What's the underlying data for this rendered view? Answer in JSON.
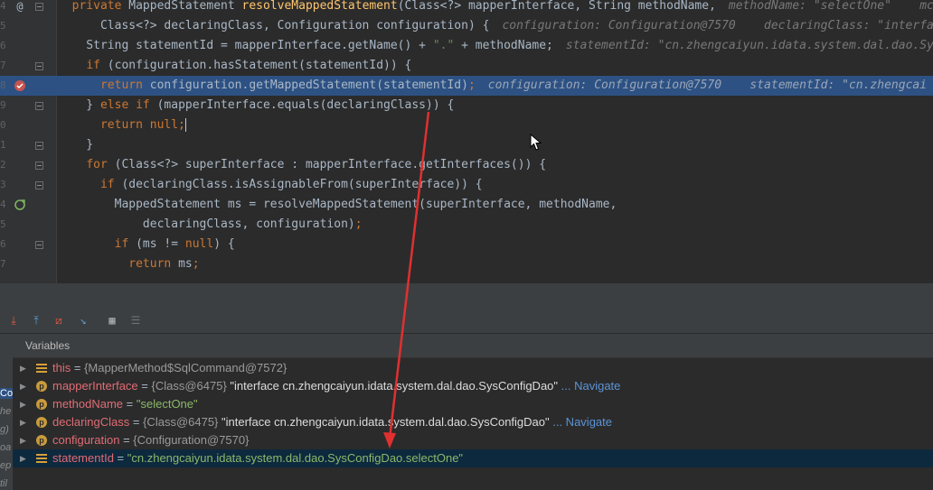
{
  "editor": {
    "lines": [
      {
        "num": "4",
        "html": "  <span class=\"kw\">private</span> MappedStatement <span class=\"fn\">resolveMappedStatement</span>(Class&lt;?&gt; mapperInterface, String methodName,<span class=\"hint\">methodName: \"selectOne\"    mc</span>",
        "gutter_icon": "@",
        "fold": true
      },
      {
        "num": "5",
        "html": "      Class&lt;?&gt; declaringClass, Configuration configuration) {<span class=\"hint\">configuration: Configuration@7570    declaringClass: \"interfa</span>",
        "fold": false
      },
      {
        "num": "6",
        "html": "    String statementId = mapperInterface.getName() + <span class=\"str\">\".\"</span> + methodName;<span class=\"hint\">statementId: \"cn.zhengcaiyun.idata.system.dal.dao.Sy</span>",
        "fold": false
      },
      {
        "num": "7",
        "html": "    <span class=\"kw\">if</span> (configuration.hasStatement(statementId)) {",
        "fold": true
      },
      {
        "num": "8",
        "html": "      <span class=\"kw\">return</span> configuration.getMappedStatement(statementId)<span class=\"kw\">;</span><span class=\"hint\">configuration: Configuration@7570    statementId: \"cn.zhengcai</span>",
        "gutter_icon": "breakpoint",
        "highlight": true,
        "fold": false
      },
      {
        "num": "9",
        "html": "    } <span class=\"kw\">else if</span> (mapperInterface.equals(declaringClass)) {",
        "fold": true
      },
      {
        "num": "0",
        "html": "      <span class=\"kw\">return null;</span><span class=\"caret\"></span>",
        "fold": false
      },
      {
        "num": "1",
        "html": "    }",
        "fold": true
      },
      {
        "num": "2",
        "html": "    <span class=\"kw\">for</span> (Class&lt;?&gt; superInterface : mapperInterface.getInterfaces()) {",
        "fold": true
      },
      {
        "num": "3",
        "html": "      <span class=\"kw\">if</span> (declaringClass.isAssignableFrom(superInterface)) {",
        "fold": true
      },
      {
        "num": "4",
        "html": "        MappedStatement ms = resolveMappedStatement(superInterface, methodName,",
        "gutter_icon": "recursion",
        "fold": false
      },
      {
        "num": "5",
        "html": "            declaringClass, configuration)<span class=\"kw\">;</span>",
        "fold": false
      },
      {
        "num": "6",
        "html": "        <span class=\"kw\">if</span> (ms != <span class=\"kw\">null</span>) {",
        "fold": true
      },
      {
        "num": "7",
        "html": "          <span class=\"kw\">return</span> ms<span class=\"kw\">;</span>",
        "fold": false
      }
    ]
  },
  "toolbar": {
    "buttons": [
      "step-into-icon",
      "step-out-icon",
      "drop-frame-icon",
      "run-to-cursor-icon",
      "evaluate-icon",
      "trace-icon"
    ]
  },
  "variables": {
    "title": "Variables",
    "rows": [
      {
        "icon": "lines",
        "name": "this",
        "eq": " = ",
        "value_obj": "{MapperMethod$SqlCommand@7572}",
        "value_str": "",
        "nav": ""
      },
      {
        "icon": "p",
        "name": "mapperInterface",
        "eq": " = ",
        "value_obj": "{Class@6475}",
        "value_str": " \"interface cn.zhengcaiyun.idata.system.dal.dao.SysConfigDao\"",
        "nav": " ... Navigate"
      },
      {
        "icon": "p",
        "name": "methodName",
        "eq": " = ",
        "value_obj": "",
        "value_str": "\"selectOne\"",
        "nav": ""
      },
      {
        "icon": "p",
        "name": "declaringClass",
        "eq": " = ",
        "value_obj": "{Class@6475}",
        "value_str": " \"interface cn.zhengcaiyun.idata.system.dal.dao.SysConfigDao\"",
        "nav": " ... Navigate"
      },
      {
        "icon": "p",
        "name": "configuration",
        "eq": " = ",
        "value_obj": "{Configuration@7570}",
        "value_str": "",
        "nav": ""
      },
      {
        "icon": "lines",
        "name": "statementId",
        "eq": " = ",
        "value_obj": "",
        "value_str": "\"cn.zhengcaiyun.idata.system.dal.dao.SysConfigDao.selectOne\"",
        "nav": "",
        "selected": true
      }
    ]
  },
  "left_strip": [
    "Co",
    "he",
    "g)",
    "oa",
    "ep",
    "til"
  ],
  "colors": {
    "arrow": "#e03030",
    "highlight": "#2d5183",
    "breakpoint": "#c75450"
  }
}
